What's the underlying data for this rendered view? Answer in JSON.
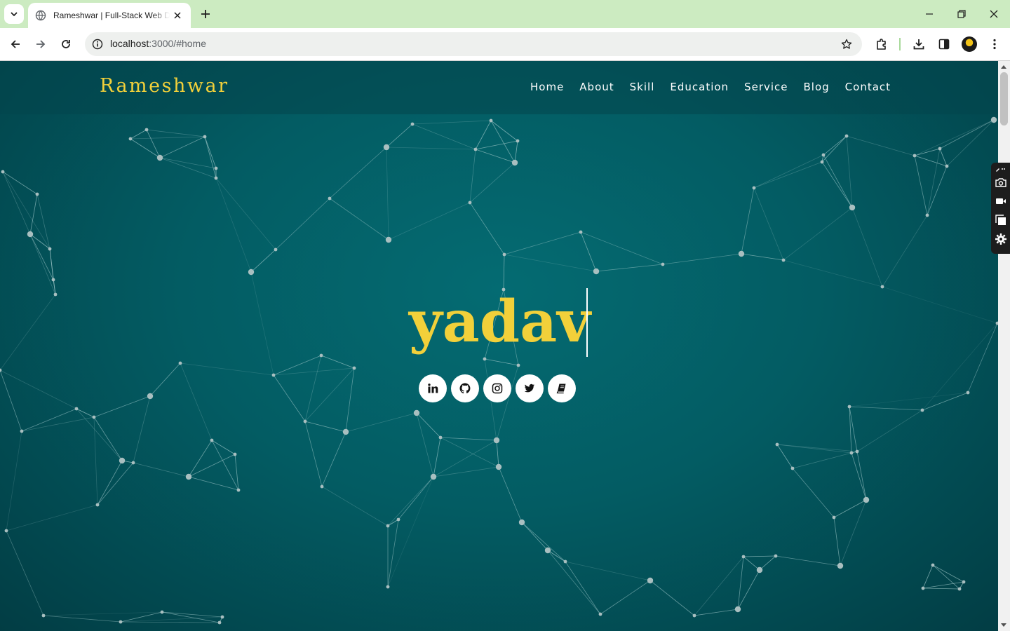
{
  "browser": {
    "tab_title": "Rameshwar | Full-Stack Web Developer",
    "url_host": "localhost",
    "url_rest": ":3000/#home"
  },
  "site": {
    "brand": "Rameshwar",
    "nav": [
      "Home",
      "About",
      "Skill",
      "Education",
      "Service",
      "Blog",
      "Contact"
    ],
    "hero_text": "yadav",
    "socials": [
      "linkedin-icon",
      "github-icon",
      "instagram-icon",
      "twitter-icon",
      "book-icon"
    ],
    "colors": {
      "accent": "#f2d03a",
      "background": "#035c63",
      "header": "#03464c"
    }
  }
}
